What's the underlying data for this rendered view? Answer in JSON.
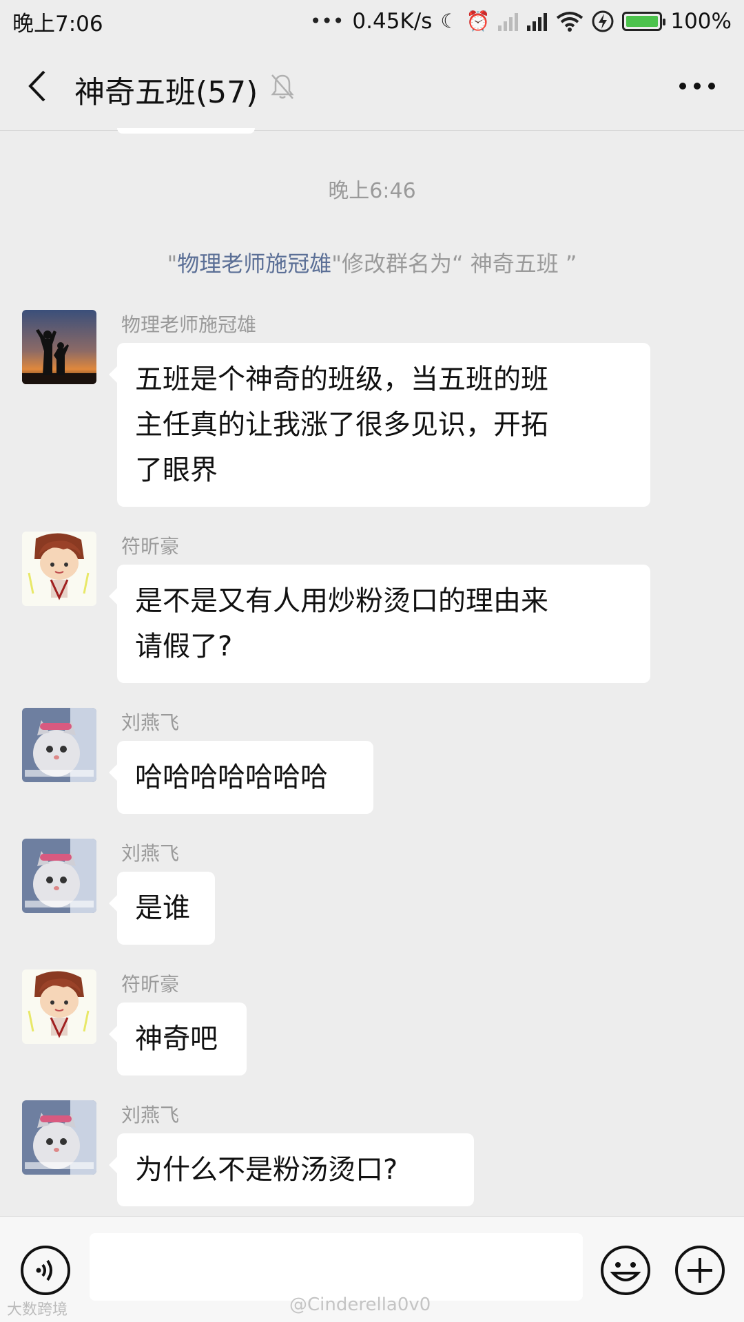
{
  "status_bar": {
    "time": "晚上7:06",
    "network_speed": "0.45K/s",
    "battery": "100%",
    "icons": [
      "dots-icon",
      "moon-icon",
      "alarm-icon",
      "signal-icon",
      "signal-icon",
      "wifi-icon",
      "charge-icon",
      "battery-icon"
    ]
  },
  "header": {
    "title": "神奇五班(57)",
    "icons": [
      "back-icon",
      "mute-icon",
      "more-icon"
    ]
  },
  "timestamp": "晚上6:46",
  "system_message": {
    "quote_open": "\"",
    "name": "物理老师施冠雄",
    "text": "\"修改群名为“ 神奇五班 ”"
  },
  "messages": [
    {
      "sender": "物理老师施冠雄",
      "lines": [
        "五班是个神奇的班级，当五班的班",
        "主任真的让我涨了很多见识，开拓",
        "了眼界"
      ]
    },
    {
      "sender": "符昕豪",
      "lines": [
        "是不是又有人用炒粉烫口的理由来",
        "请假了?"
      ]
    },
    {
      "sender": "刘燕飞",
      "lines": [
        "哈哈哈哈哈哈哈"
      ]
    },
    {
      "sender": "刘燕飞",
      "lines": [
        "是谁"
      ]
    },
    {
      "sender": "符昕豪",
      "lines": [
        "神奇吧"
      ]
    },
    {
      "sender": "刘燕飞",
      "lines": [
        "为什么不是粉汤烫口?"
      ]
    }
  ],
  "input_bar": {
    "placeholder": "",
    "icons": [
      "voice-icon",
      "emoji-icon",
      "plus-icon"
    ]
  },
  "watermarks": {
    "left": "大数跨境",
    "right": "@Cinderella0v0"
  },
  "colors": {
    "background": "#ededed",
    "bubble": "#ffffff",
    "link": "#5b6f96",
    "meta_text": "#9a9a9a"
  }
}
